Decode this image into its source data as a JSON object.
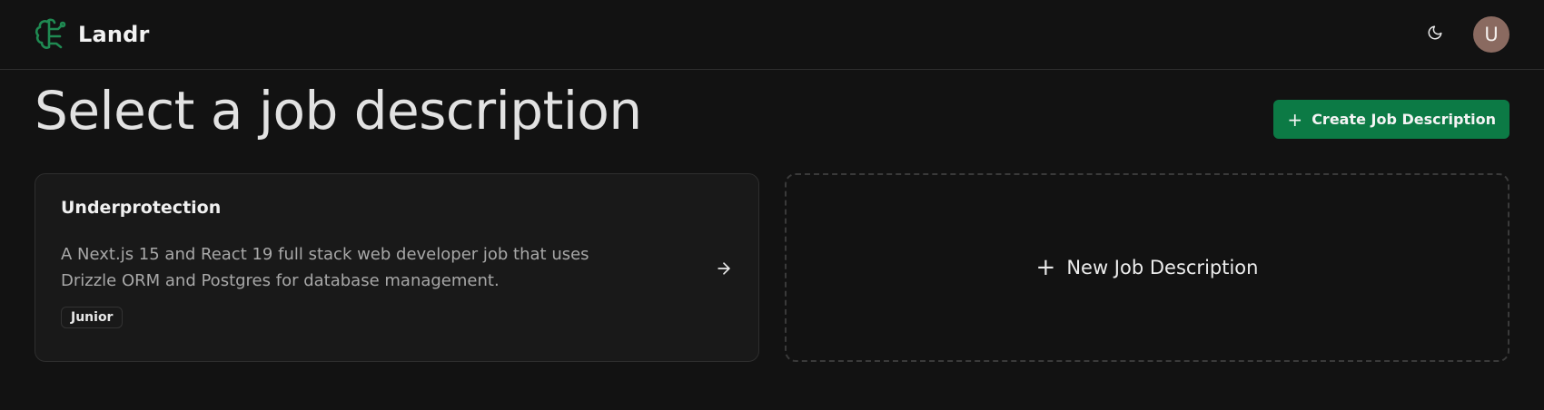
{
  "navbar": {
    "brand_name": "Landr",
    "user_initial": "U",
    "icons": {
      "logo": "brain-icon",
      "theme": "moon-icon"
    }
  },
  "header": {
    "title": "Select a job description",
    "create_button_label": "Create Job Description"
  },
  "job_cards": [
    {
      "title": "Underprotection",
      "description": "A Next.js 15 and React 19 full stack web developer job that uses Drizzle ORM and Postgres for database management.",
      "badge": "Junior"
    }
  ],
  "new_card": {
    "label": "New Job Description"
  },
  "colors": {
    "accent": "#0c7a45",
    "background": "#121212",
    "card": "#191919"
  }
}
